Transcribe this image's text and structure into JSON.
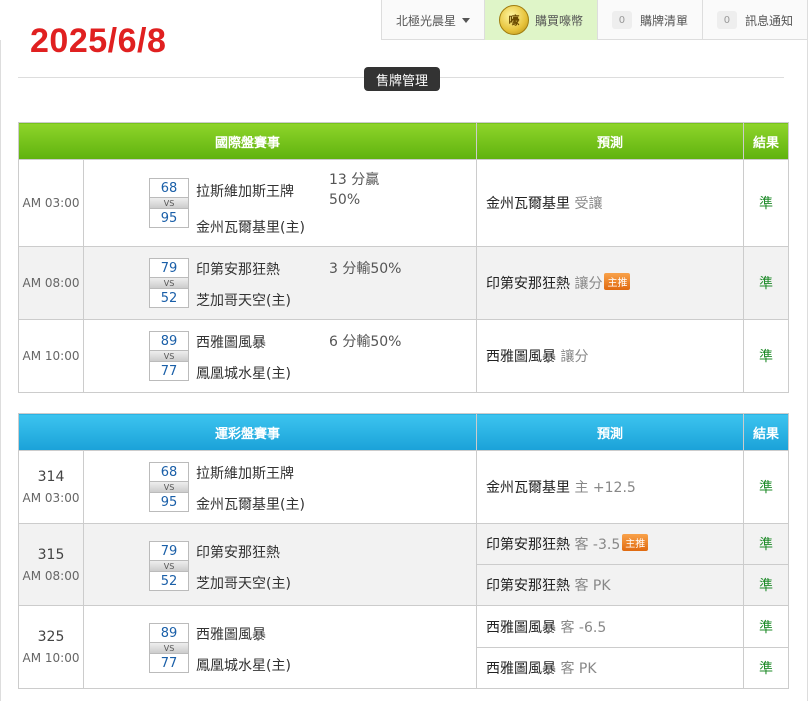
{
  "date_stamp": "2025/6/8",
  "topnav": {
    "region": "北極光晨星",
    "buy": "購買嚎幣",
    "coin_glyph": "嚎",
    "list_count": "0",
    "list": "購牌清單",
    "msg_count": "0",
    "msg": "訊息通知"
  },
  "section_title": "售牌管理",
  "international": {
    "header": {
      "events": "國際盤賽事",
      "prediction": "預測",
      "result": "結果"
    },
    "rows": [
      {
        "time": "AM 03:00",
        "s1": "68",
        "vs": "VS",
        "s2": "95",
        "t1": "拉斯維加斯王牌",
        "t2": "金州瓦爾基里(主)",
        "spread": "13 分贏 50%",
        "pred_team": "金州瓦爾基里",
        "pred_type": "受讓",
        "result": "準"
      },
      {
        "time": "AM 08:00",
        "s1": "79",
        "vs": "VS",
        "s2": "52",
        "t1": "印第安那狂熱",
        "t2": "芝加哥天空(主)",
        "spread": "3 分輸50%",
        "pred_team": "印第安那狂熱",
        "pred_type": "讓分",
        "badge": "主推",
        "result": "準"
      },
      {
        "time": "AM 10:00",
        "s1": "89",
        "vs": "VS",
        "s2": "77",
        "t1": "西雅圖風暴",
        "t2": "鳳凰城水星(主)",
        "spread": "6 分輸50%",
        "pred_team": "西雅圖風暴",
        "pred_type": "讓分",
        "result": "準"
      }
    ]
  },
  "lottery": {
    "header": {
      "events": "運彩盤賽事",
      "prediction": "預測",
      "result": "結果"
    },
    "rows": [
      {
        "num": "314",
        "time": "AM 03:00",
        "s1": "68",
        "vs": "VS",
        "s2": "95",
        "t1": "拉斯維加斯王牌",
        "t2": "金州瓦爾基里(主)",
        "preds": [
          {
            "team": "金州瓦爾基里",
            "type": "主 +12.5",
            "result": "準"
          }
        ]
      },
      {
        "num": "315",
        "time": "AM 08:00",
        "s1": "79",
        "vs": "VS",
        "s2": "52",
        "t1": "印第安那狂熱",
        "t2": "芝加哥天空(主)",
        "preds": [
          {
            "team": "印第安那狂熱",
            "type": "客 -3.5",
            "badge": "主推",
            "result": "準"
          },
          {
            "team": "印第安那狂熱",
            "type": "客 PK",
            "result": "準"
          }
        ]
      },
      {
        "num": "325",
        "time": "AM 10:00",
        "s1": "89",
        "vs": "VS",
        "s2": "77",
        "t1": "西雅圖風暴",
        "t2": "鳳凰城水星(主)",
        "preds": [
          {
            "team": "西雅圖風暴",
            "type": "客 -6.5",
            "result": "準"
          },
          {
            "team": "西雅圖風暴",
            "type": "客 PK",
            "result": "準"
          }
        ]
      }
    ]
  }
}
